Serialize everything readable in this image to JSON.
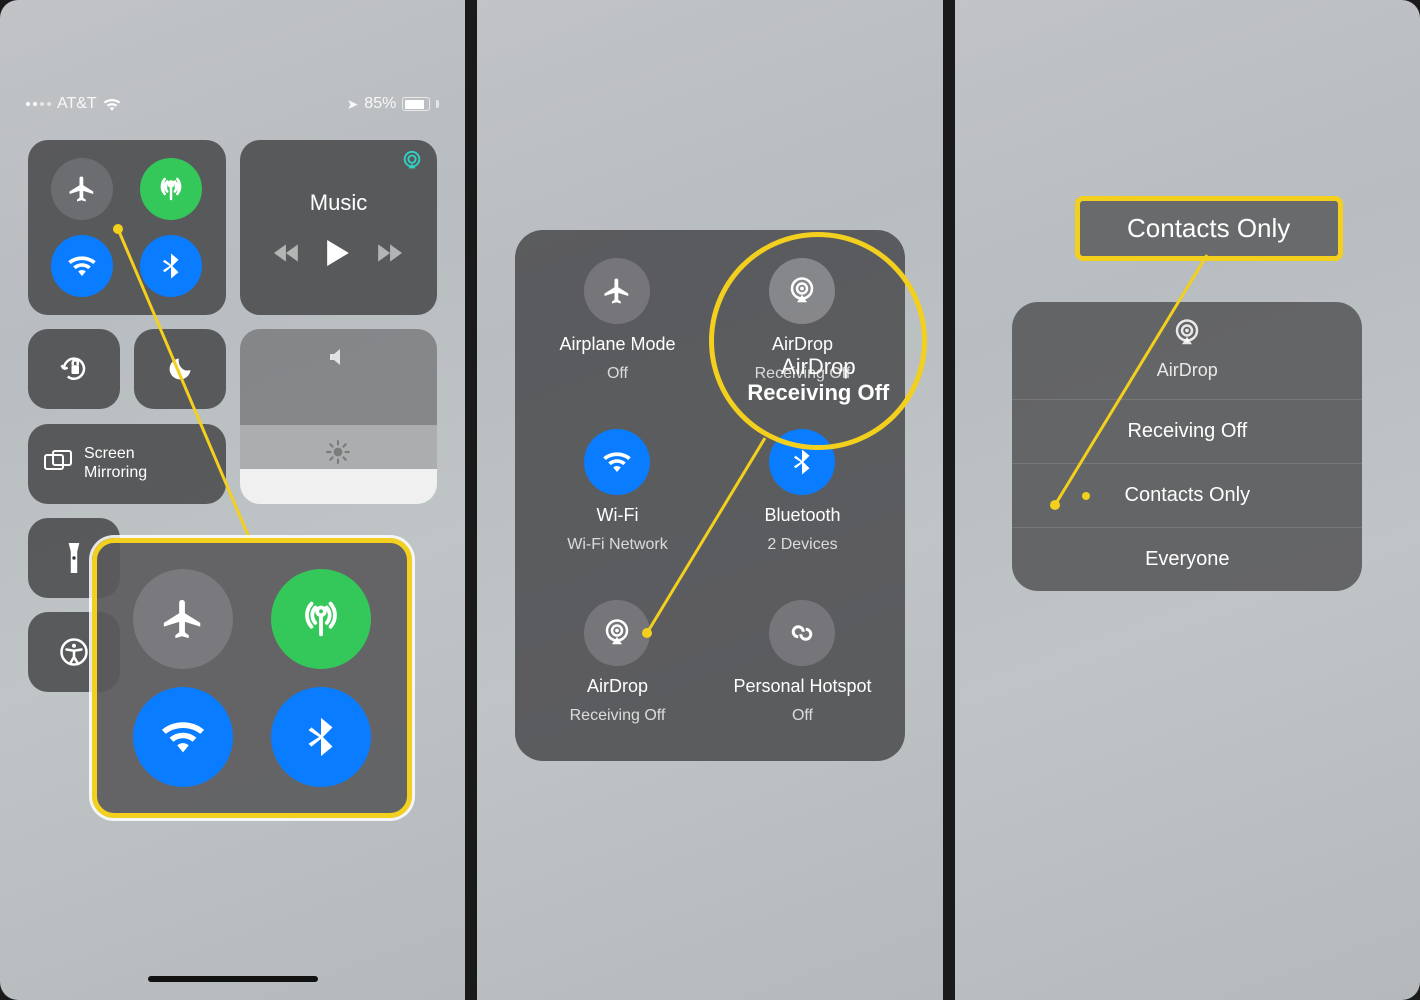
{
  "status": {
    "carrier": "AT&T",
    "battery_pct": "85%"
  },
  "panel1": {
    "music_label": "Music",
    "screen_mirroring": "Screen\nMirroring"
  },
  "panel2": {
    "items": {
      "airplane": {
        "label": "Airplane Mode",
        "sub": "Off"
      },
      "airdrop": {
        "label": "AirDrop",
        "sub": "Receiving Off"
      },
      "wifi": {
        "label": "Wi-Fi",
        "sub": "Wi-Fi Network"
      },
      "bluetooth": {
        "label": "Bluetooth",
        "sub": "2 Devices"
      },
      "airdrop2": {
        "label": "AirDrop",
        "sub": "Receiving Off"
      },
      "hotspot": {
        "label": "Personal Hotspot",
        "sub": "Off"
      }
    },
    "callout_l1": "AirDrop",
    "callout_l2": "Receiving Off"
  },
  "panel3": {
    "header": "AirDrop",
    "options": {
      "off": "Receiving Off",
      "contacts": "Contacts Only",
      "everyone": "Everyone"
    },
    "callout": "Contacts Only"
  }
}
